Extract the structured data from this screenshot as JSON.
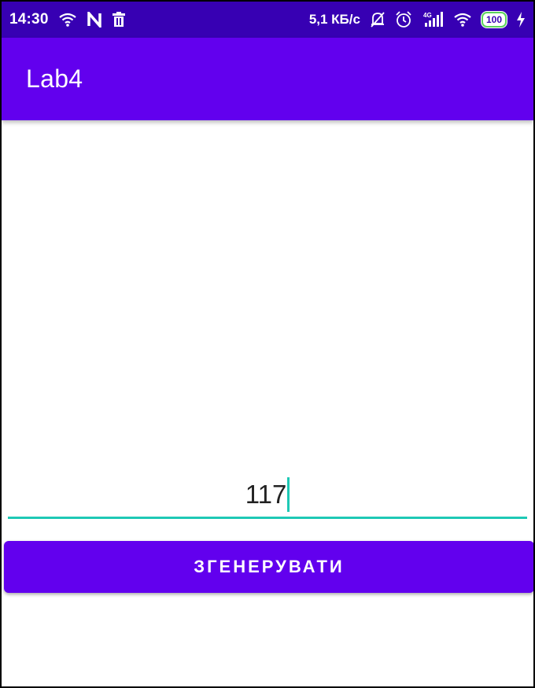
{
  "status_bar": {
    "time": "14:30",
    "speed": "5,1 КБ/с",
    "battery": "100",
    "network": "4G",
    "icons_left": [
      "wifi-icon",
      "n-app-icon",
      "trash-icon"
    ],
    "icons_right": [
      "mute-bell-icon",
      "alarm-icon",
      "signal-icon",
      "wifi-icon",
      "battery-icon",
      "charging-icon"
    ]
  },
  "app_bar": {
    "title": "Lab4"
  },
  "input": {
    "value": "117"
  },
  "button": {
    "label": "ЗГЕНЕРУВАТИ"
  },
  "colors": {
    "status_bar": "#3700b3",
    "primary": "#6200ee",
    "accent": "#1ec9b5",
    "background": "#ffffff"
  }
}
